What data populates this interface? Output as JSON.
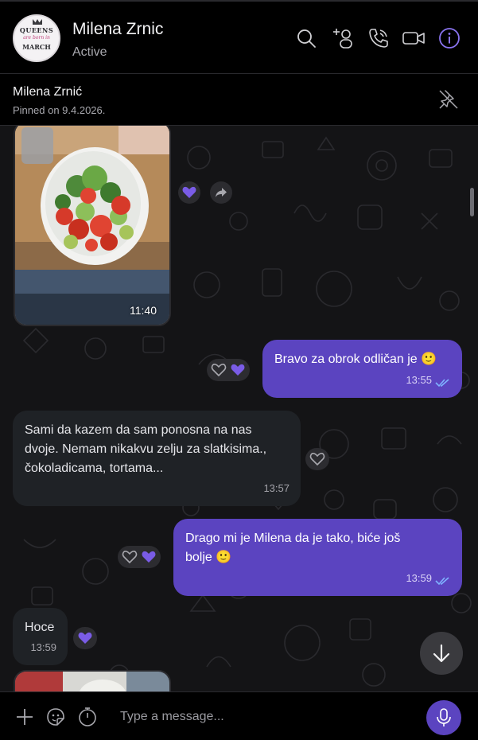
{
  "header": {
    "contact_name": "Milena Zrnic",
    "status": "Active",
    "avatar_line1": "QUEENS",
    "avatar_line2": "are born in",
    "avatar_line3": "MARCH"
  },
  "pinned": {
    "name": "Milena Zrnić",
    "date_text": "Pinned on 9.4.2026."
  },
  "messages": [
    {
      "type": "photo",
      "direction": "incoming",
      "time": "11:40",
      "reactions": [
        "heart-filled-purple",
        "forward"
      ]
    },
    {
      "type": "text",
      "direction": "outgoing",
      "text": "Bravo za obrok odličan je 🙂",
      "time": "13:55",
      "status": "read",
      "reactions": [
        "heart-outline",
        "heart-filled-purple"
      ]
    },
    {
      "type": "text",
      "direction": "incoming",
      "text": "Sami da kazem da sam ponosna na nas dvoje. Nemam nikakvu zelju za slatkisima., čokoladicama, tortama...",
      "time": "13:57",
      "reactions": [
        "heart-outline"
      ]
    },
    {
      "type": "text",
      "direction": "outgoing",
      "text": "Drago mi je Milena da je tako, biće još bolje 🙂",
      "time": "13:59",
      "status": "read",
      "reactions": [
        "heart-outline",
        "heart-filled-purple"
      ]
    },
    {
      "type": "text",
      "direction": "incoming",
      "text": "Hoce",
      "time": "13:59",
      "reactions": [
        "heart-filled-purple"
      ]
    },
    {
      "type": "photo",
      "direction": "incoming",
      "time": "",
      "reactions": []
    }
  ],
  "composer": {
    "placeholder": "Type a message..."
  },
  "colors": {
    "accent": "#5b44c0",
    "incoming_bubble": "#1f2226",
    "background": "#000000",
    "read_ticks": "#7fb2ff"
  },
  "icons": {
    "header": [
      "search-icon",
      "add-participant-icon",
      "call-icon",
      "video-call-icon",
      "info-icon"
    ],
    "composer": [
      "add-icon",
      "sticker-icon",
      "timer-icon",
      "mic-icon"
    ],
    "other": [
      "unpin-icon",
      "scroll-down-icon"
    ]
  }
}
